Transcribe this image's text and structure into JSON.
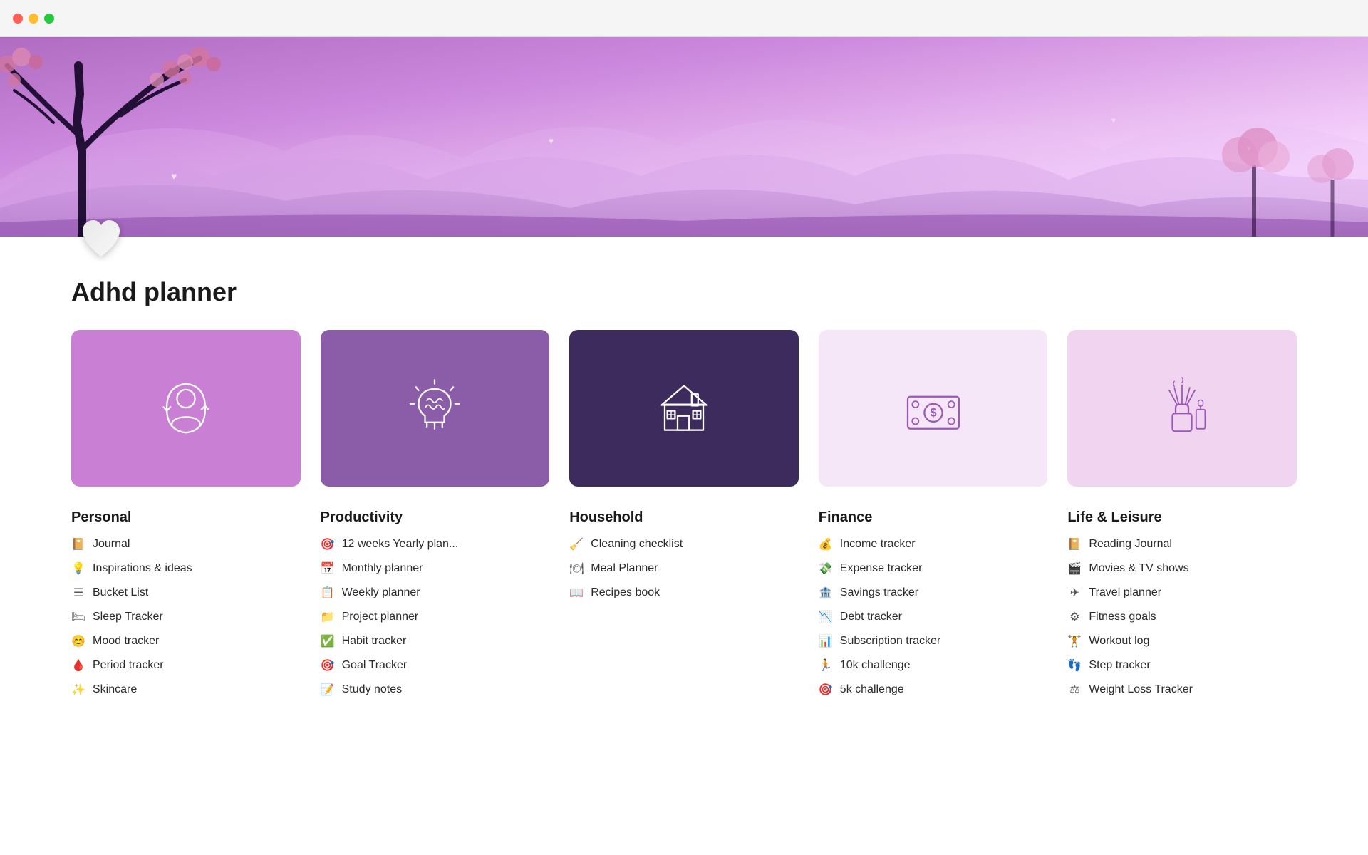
{
  "window": {
    "dots": [
      "red",
      "yellow",
      "green"
    ]
  },
  "page_title": "Adhd planner",
  "cards": [
    {
      "id": "personal",
      "label": "Personal",
      "color_class": "card-personal"
    },
    {
      "id": "productivity",
      "label": "Productivity",
      "color_class": "card-productivity"
    },
    {
      "id": "household",
      "label": "Household",
      "color_class": "card-household"
    },
    {
      "id": "finance",
      "label": "Finance",
      "color_class": "card-finance"
    },
    {
      "id": "leisure",
      "label": "Life & Leisure",
      "color_class": "card-leisure"
    }
  ],
  "sections": {
    "personal": {
      "title": "Personal",
      "items": [
        {
          "icon": "📔",
          "label": "Journal"
        },
        {
          "icon": "💡",
          "label": "Inspirations & ideas"
        },
        {
          "icon": "≡",
          "label": "Bucket List"
        },
        {
          "icon": "🛏",
          "label": "Sleep Tracker"
        },
        {
          "icon": "😊",
          "label": "Mood tracker"
        },
        {
          "icon": "🩸",
          "label": "Period tracker"
        },
        {
          "icon": "✨",
          "label": "Skincare"
        }
      ]
    },
    "productivity": {
      "title": "Productivity",
      "items": [
        {
          "icon": "🎯",
          "label": "12 weeks Yearly plan..."
        },
        {
          "icon": "📅",
          "label": "Monthly planner"
        },
        {
          "icon": "📋",
          "label": "Weekly planner"
        },
        {
          "icon": "📁",
          "label": "Project planner"
        },
        {
          "icon": "✅",
          "label": "Habit tracker"
        },
        {
          "icon": "🎯",
          "label": "Goal Tracker"
        },
        {
          "icon": "📝",
          "label": "Study notes"
        }
      ]
    },
    "household": {
      "title": "Household",
      "items": [
        {
          "icon": "🧹",
          "label": "Cleaning checklist"
        },
        {
          "icon": "🍽",
          "label": "Meal Planner"
        },
        {
          "icon": "📖",
          "label": "Recipes book"
        }
      ]
    },
    "finance": {
      "title": "Finance",
      "items": [
        {
          "icon": "💰",
          "label": "Income tracker"
        },
        {
          "icon": "💸",
          "label": "Expense tracker"
        },
        {
          "icon": "🏦",
          "label": "Savings tracker"
        },
        {
          "icon": "📉",
          "label": "Debt tracker"
        },
        {
          "icon": "📊",
          "label": "Subscription tracker"
        },
        {
          "icon": "🏃",
          "label": "10k challenge"
        },
        {
          "icon": "🎯",
          "label": "5k challenge"
        }
      ]
    },
    "leisure": {
      "title": "Life & Leisure",
      "items": [
        {
          "icon": "📔",
          "label": "Reading Journal"
        },
        {
          "icon": "🎬",
          "label": "Movies & TV shows"
        },
        {
          "icon": "✈",
          "label": "Travel planner"
        },
        {
          "icon": "⚙",
          "label": "Fitness goals"
        },
        {
          "icon": "🏋",
          "label": "Workout log"
        },
        {
          "icon": "👣",
          "label": "Step tracker"
        },
        {
          "icon": "⚖",
          "label": "Weight Loss Tracker"
        }
      ]
    }
  }
}
